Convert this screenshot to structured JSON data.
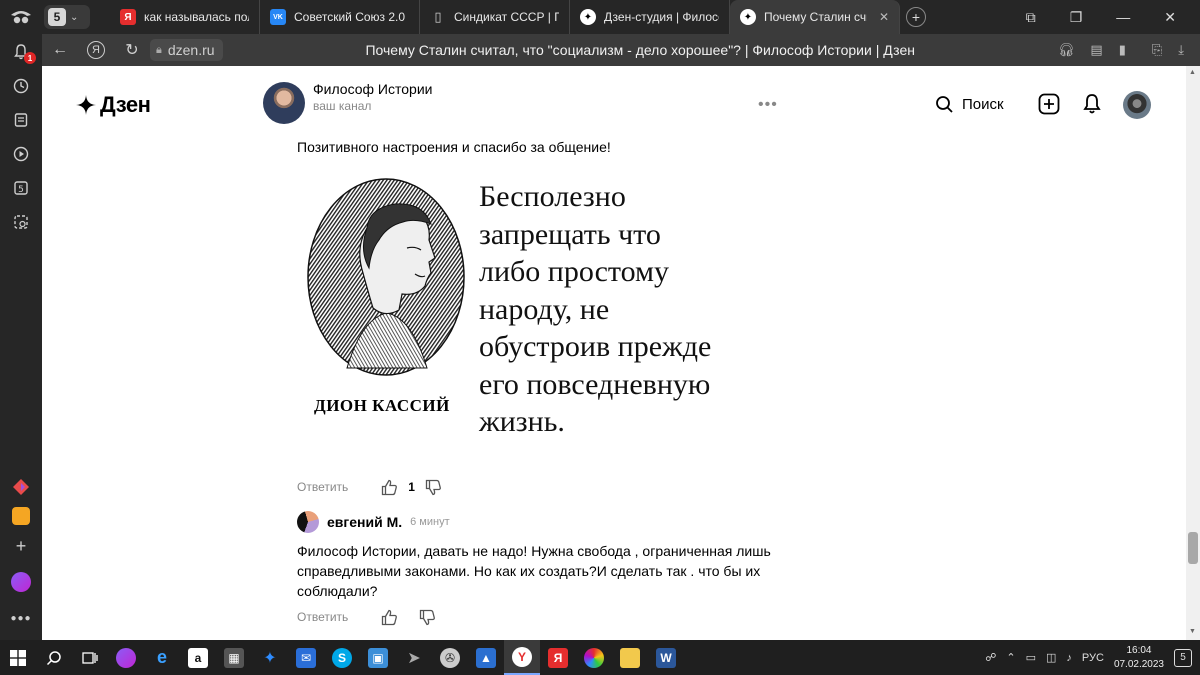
{
  "browser": {
    "tab_count": "5",
    "tabs": [
      {
        "label": "как называлась польша",
        "icon": "yandex-icon",
        "color": "#e52e2e"
      },
      {
        "label": "Советский Союз 2.0",
        "icon": "vk-icon",
        "color": "#2787f5"
      },
      {
        "label": "Синдикат СССР | Паблик",
        "icon": "page-icon",
        "color": "#888888"
      },
      {
        "label": "Дзен-студия | Философ",
        "icon": "dzen-icon",
        "color": "#000000"
      },
      {
        "label": "Почему Сталин считал",
        "icon": "dzen-icon",
        "color": "#000000",
        "active": true
      }
    ],
    "url": "dzen.ru",
    "page_title": "Почему Сталин считал, что \"социализм - дело хорошее\"? | Философ Истории | Дзен",
    "left_badge": "1"
  },
  "header": {
    "logo": "Дзен",
    "channel_name": "Философ Истории",
    "channel_sub": "ваш канал",
    "search_label": "Поиск"
  },
  "comment1": {
    "text": "Позитивного настроения и спасибо за общение!",
    "image": {
      "caption": "ДИОН КАССИЙ",
      "quote_lines": [
        "Бесполезно",
        "запрещать что",
        "либо простому",
        "народу, не",
        "обустроив прежде",
        "его повседневную",
        "жизнь."
      ]
    },
    "reply_label": "Ответить",
    "likes": "1"
  },
  "comment2": {
    "author": "евгений М.",
    "time": "6 минут",
    "text_lines": [
      "Философ Истории, давать не надо! Нужна свобода , ограниченная лишь",
      "справедливыми законами. Но как их создать?И сделать так . что бы их",
      "соблюдали?"
    ],
    "reply_label": "Ответить"
  },
  "taskbar": {
    "lang": "РУС",
    "time": "16:04",
    "date": "07.02.2023",
    "notif_count": "5"
  }
}
